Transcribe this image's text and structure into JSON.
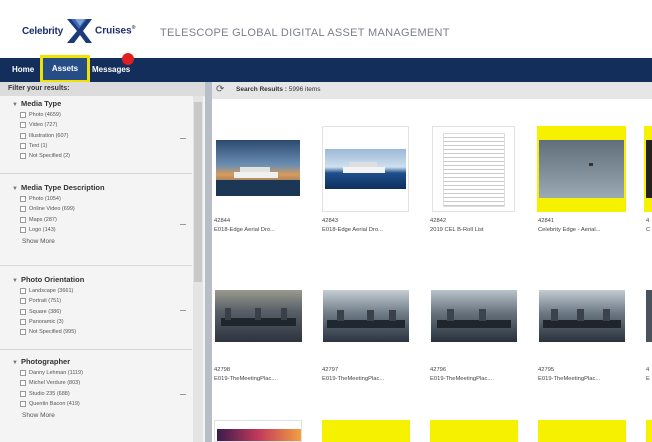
{
  "header": {
    "logo_left": "Celebrity",
    "logo_right": "Cruises",
    "app_title": "TELESCOPE GLOBAL DIGITAL ASSET MANAGEMENT"
  },
  "nav": {
    "home": "Home",
    "assets": "Assets",
    "messages": "Messages"
  },
  "sidebar": {
    "title": "Filter your results:",
    "groups": [
      {
        "title": "Media Type",
        "options": [
          "Photo (4659)",
          "Video (727)",
          "Illustration (607)",
          "Text (1)",
          "Not Specified (2)"
        ],
        "show_more": ""
      },
      {
        "title": "Media Type Description",
        "options": [
          "Photo (1054)",
          "Online Video (699)",
          "Maps (287)",
          "Logo (143)"
        ],
        "show_more": "Show More"
      },
      {
        "title": "Photo Orientation",
        "options": [
          "Landscape (3661)",
          "Portrait (751)",
          "Square (386)",
          "Panoramic (3)",
          "Not Specified (995)"
        ],
        "show_more": ""
      },
      {
        "title": "Photographer",
        "options": [
          "Danny Lehman (1119)",
          "Michel Verdure (803)",
          "Studio 235 (688)",
          "Quentin Bacon (419)"
        ],
        "show_more": "Show More"
      }
    ]
  },
  "results": {
    "label": "Search Results :",
    "count": "5996 items"
  },
  "assets": [
    {
      "id": "42844",
      "name": "E018-Edge Aerial Dro..."
    },
    {
      "id": "42843",
      "name": "E018-Edge Aerial Dro..."
    },
    {
      "id": "42842",
      "name": "2019 CEL B-Roll List"
    },
    {
      "id": "42841",
      "name": "Celebrity Edge - Aerial..."
    },
    {
      "id": "4",
      "name": "C"
    },
    {
      "id": "42798",
      "name": "E019-TheMeetingPlac..."
    },
    {
      "id": "42797",
      "name": "E019-TheMeetingPlac..."
    },
    {
      "id": "42796",
      "name": "E019-TheMeetingPlac..."
    },
    {
      "id": "42795",
      "name": "E019-TheMeetingPlac..."
    },
    {
      "id": "4",
      "name": "E"
    }
  ],
  "colors": {
    "nav_bg": "#142e5c",
    "highlight": "#f2e200",
    "notification": "#e02020"
  }
}
